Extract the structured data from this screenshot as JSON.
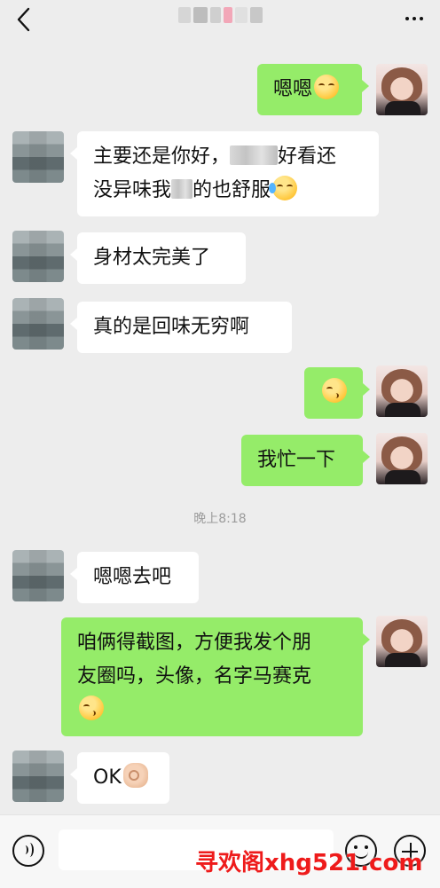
{
  "header": {
    "back_icon": "chevron-left-icon",
    "more_icon": "more-dots-icon"
  },
  "messages": [
    {
      "side": "right",
      "text": "嗯嗯",
      "emoji": "smile-emoji"
    },
    {
      "side": "left",
      "line1_a": "主要还是你好，",
      "line1_b": "好看还",
      "line2_a": "没异味我",
      "line2_b": "的也舒服",
      "emoji": "laugh-cry-emoji"
    },
    {
      "side": "left",
      "text": "身材太完美了"
    },
    {
      "side": "left",
      "text": "真的是回味无穷啊"
    },
    {
      "side": "right",
      "text": "",
      "emoji": "kiss-emoji"
    },
    {
      "side": "right",
      "text": "我忙一下"
    },
    {
      "side": "left",
      "text": "嗯嗯去吧"
    },
    {
      "side": "right",
      "line1": "咱俩得截图，方便我发个朋",
      "line2": "友圈吗，头像，名字马赛克",
      "emoji": "kiss-emoji"
    },
    {
      "side": "left",
      "text": "OK",
      "emoji": "ok-hand-emoji"
    }
  ],
  "timestamp": "晚上8:18",
  "input_bar": {
    "voice_icon": "voice-icon",
    "emoji_icon": "emoji-icon",
    "plus_icon": "plus-icon",
    "text_value": ""
  },
  "watermark": "寻欢阁xhg521.com",
  "colors": {
    "background": "#ededed",
    "sent_bubble": "#95ec69",
    "received_bubble": "#ffffff",
    "watermark": "#ee1b1b"
  }
}
